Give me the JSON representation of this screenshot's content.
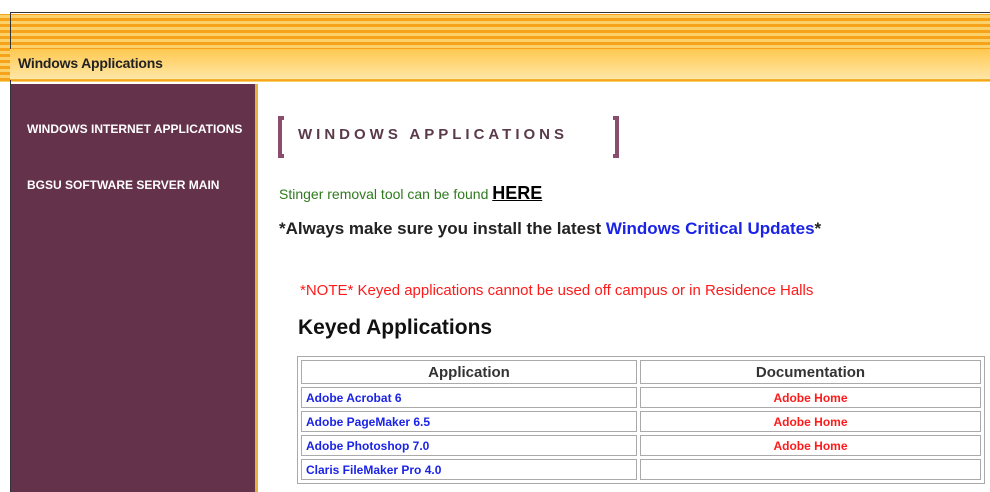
{
  "header": {
    "title": "Windows Applications"
  },
  "sidebar": {
    "items": [
      {
        "label": "WINDOWS INTERNET APPLICATIONS"
      },
      {
        "label": "BGSU SOFTWARE SERVER MAIN"
      }
    ]
  },
  "main": {
    "heading": "WINDOWS APPLICATIONS",
    "stinger_text": "Stinger removal tool can be found ",
    "stinger_link": "HERE",
    "always_prefix": "*Always make sure you install the latest ",
    "always_link": "Windows Critical Updates",
    "always_suffix": "*",
    "note": "*NOTE* Keyed applications cannot be used off campus or in Residence Halls",
    "section_title": "Keyed Applications",
    "table": {
      "headers": [
        "Application",
        "Documentation"
      ],
      "rows": [
        {
          "application": "Adobe Acrobat 6",
          "documentation": "Adobe Home"
        },
        {
          "application": "Adobe PageMaker 6.5",
          "documentation": "Adobe Home"
        },
        {
          "application": "Adobe Photoshop 7.0",
          "documentation": "Adobe Home"
        },
        {
          "application": "Claris FileMaker Pro 4.0",
          "documentation": ""
        }
      ]
    }
  },
  "colors": {
    "sidebar_bg": "#65324b",
    "header_gold": "#ffc850",
    "link_blue": "#1a23e6",
    "note_red": "#ff1a1a",
    "stinger_green": "#2f7a1f"
  }
}
